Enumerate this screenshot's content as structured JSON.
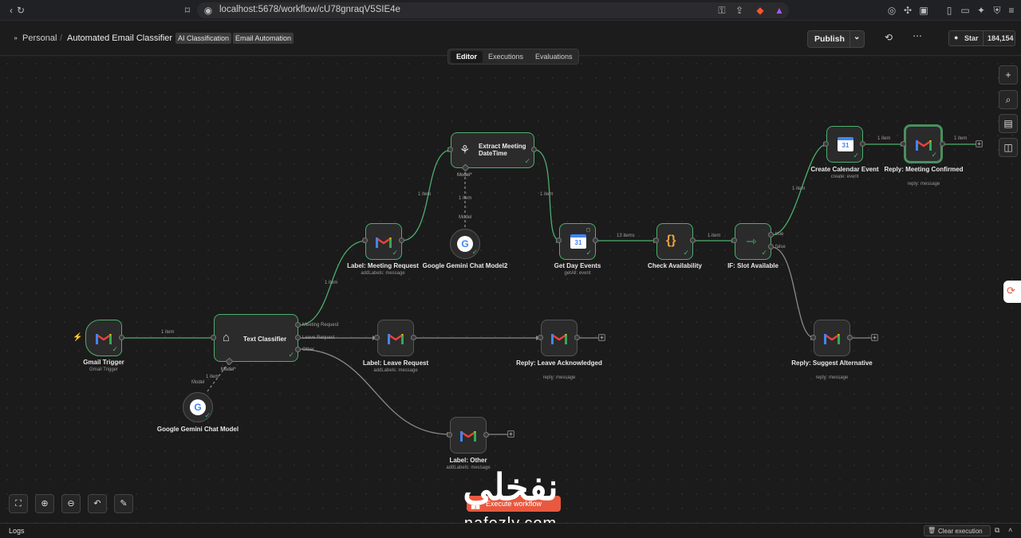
{
  "browser": {
    "url": "localhost:5678/workflow/cU78gnraqV5SIE4e"
  },
  "header": {
    "breadcrumb_root": "Personal",
    "workflow_name": "Automated Email Classifier",
    "tags": [
      "AI Classification",
      "Email Automation"
    ],
    "publish_label": "Publish",
    "github_star_label": "Star",
    "github_star_count": "184,154"
  },
  "tabs": [
    "Editor",
    "Executions",
    "Evaluations"
  ],
  "active_tab": "Editor",
  "nodes": {
    "gmail_trigger": {
      "label": "Gmail Trigger",
      "sub": "Gmail Trigger"
    },
    "text_classifier": {
      "label": "Text Classifier",
      "outputs": [
        "Meeting Request",
        "Leave Request",
        "Other"
      ],
      "model_label": "Model*"
    },
    "gemini_model": {
      "label": "Google Gemini Chat Model",
      "edge_label": "Model"
    },
    "label_meeting": {
      "label": "Label: Meeting Request",
      "sub": "addLabels: message"
    },
    "label_leave": {
      "label": "Label: Leave Request",
      "sub": "addLabels: message"
    },
    "label_other": {
      "label": "Label: Other",
      "sub": "addLabels: message"
    },
    "reply_leave": {
      "label": "Reply: Leave Acknowledged",
      "sub": "reply: message"
    },
    "extract_meeting": {
      "label": "Extract Meeting DateTime",
      "model_label": "Model*"
    },
    "gemini_model2": {
      "label": "Google Gemini Chat Model2",
      "edge_label": "Model"
    },
    "get_day_events": {
      "label": "Get Day Events",
      "sub": "getAll: event"
    },
    "check_availability": {
      "label": "Check Availability"
    },
    "if_slot": {
      "label": "IF: Slot Available",
      "outputs": [
        "true",
        "false"
      ]
    },
    "create_event": {
      "label": "Create Calendar Event",
      "sub": "create: event"
    },
    "reply_confirmed": {
      "label": "Reply: Meeting Confirmed",
      "sub": "reply: message"
    },
    "reply_alternative": {
      "label": "Reply: Suggest Alternative",
      "sub": "reply: message"
    }
  },
  "edge_labels": {
    "one_item": "1 item",
    "thirteen_items": "13 items"
  },
  "canvas_controls": [
    "fit-view",
    "zoom-in",
    "zoom-out",
    "undo",
    "tidy"
  ],
  "execute_label": "Execute workflow",
  "logs_label": "Logs",
  "clear_execution_label": "Clear execution",
  "watermark": {
    "text": "نفخلي",
    "sub": "nafezly.com"
  },
  "colors": {
    "success": "#4caf6e",
    "execute": "#e8593f",
    "canvas": "#1b1b1b"
  }
}
